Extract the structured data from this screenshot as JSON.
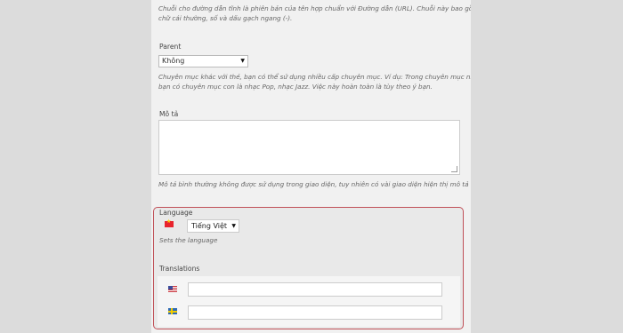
{
  "slug": {
    "help_line1": "Chuỗi cho đường dẫn tĩnh là phiên bản của tên hợp chuẩn với Đường dẫn (URL). Chuỗi này bao gồm",
    "help_line2": "chữ cái thường, số và dấu gạch ngang (-)."
  },
  "parent": {
    "label": "Parent",
    "selected": "Không",
    "help_line1": "Chuyên mục khác với thẻ, bạn có thể sử dụng nhiều cấp chuyên mục. Ví dụ: Trong chuyên mục nhạc,",
    "help_line2": "bạn có chuyên mục con là nhạc Pop, nhạc Jazz. Việc này hoàn toàn là tùy theo ý bạn."
  },
  "description": {
    "label": "Mô tả",
    "value": "",
    "help": "Mô tả bình thường không được sử dụng trong giao diện, tuy nhiên có vài giao diện hiện thị mô tả này."
  },
  "language": {
    "label": "Language",
    "selected": "Tiếng Việt",
    "help": "Sets the language",
    "flag_icon": "vietnam-flag-icon"
  },
  "translations": {
    "label": "Translations",
    "items": [
      {
        "flag_icon": "us-flag-icon",
        "value": ""
      },
      {
        "flag_icon": "sweden-flag-icon",
        "value": ""
      }
    ]
  },
  "colors": {
    "highlight_border": "#c05058",
    "page_background": "#f1f1f1"
  }
}
